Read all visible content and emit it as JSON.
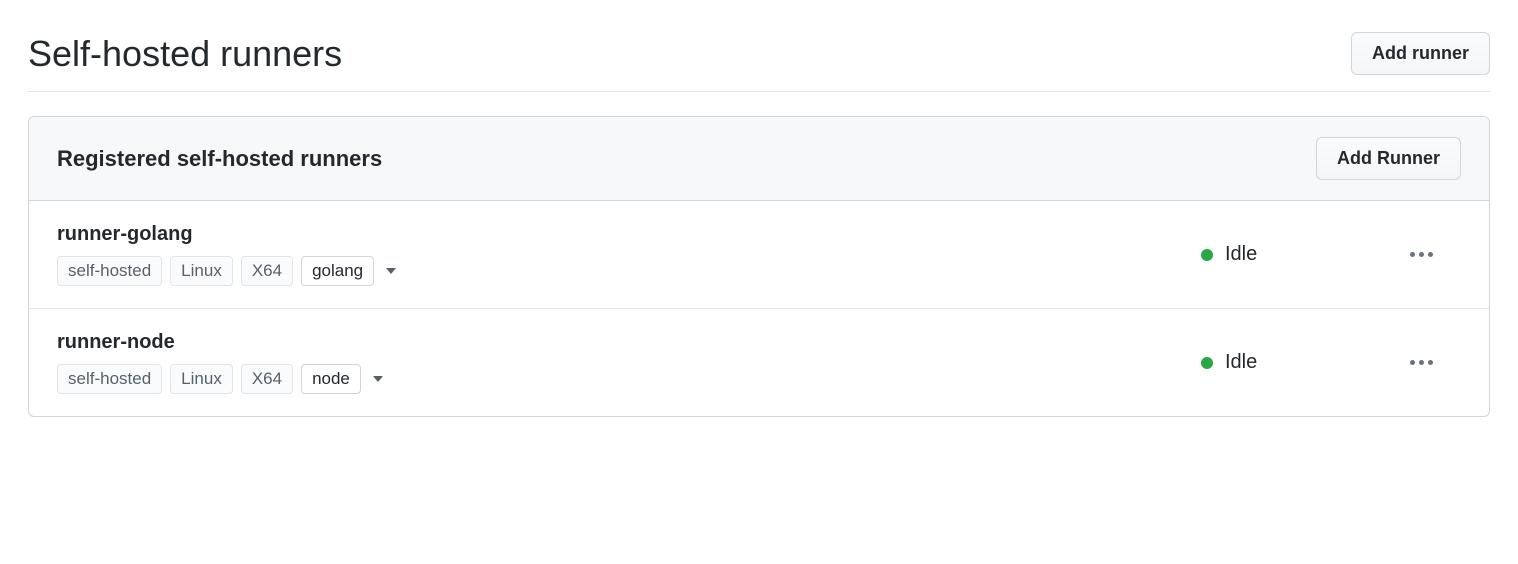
{
  "header": {
    "title": "Self-hosted runners",
    "add_button_label": "Add runner"
  },
  "panel": {
    "title": "Registered self-hosted runners",
    "add_button_label": "Add Runner"
  },
  "runners": [
    {
      "name": "runner-golang",
      "tags": [
        "self-hosted",
        "Linux",
        "X64"
      ],
      "custom_tag": "golang",
      "status": "Idle",
      "status_color": "#28a745"
    },
    {
      "name": "runner-node",
      "tags": [
        "self-hosted",
        "Linux",
        "X64"
      ],
      "custom_tag": "node",
      "status": "Idle",
      "status_color": "#28a745"
    }
  ]
}
